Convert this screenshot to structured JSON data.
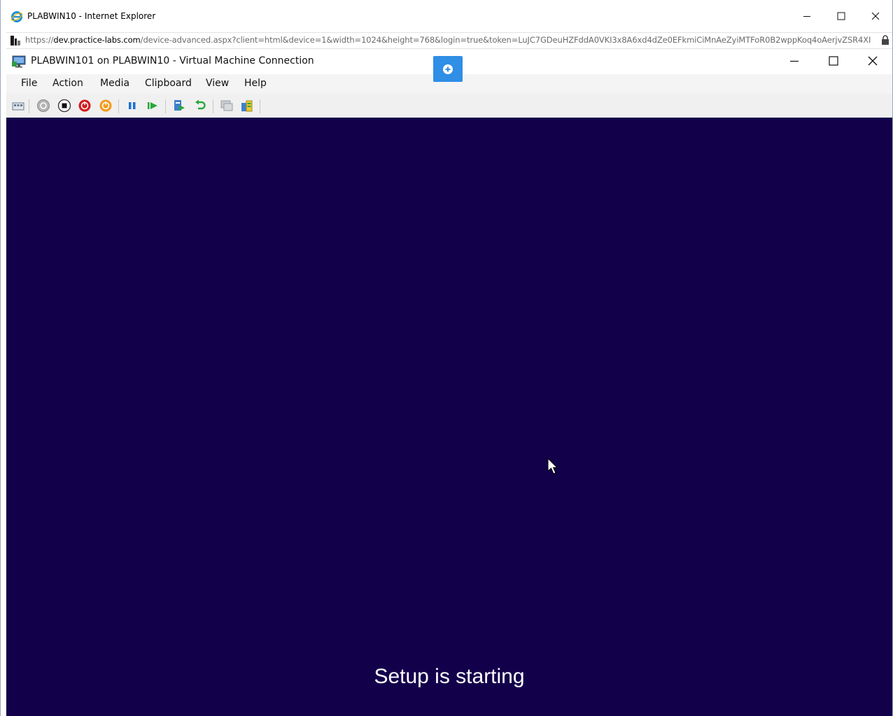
{
  "browser": {
    "title": "PLABWIN10 - Internet Explorer",
    "url_scheme": "https://",
    "url_host": "dev.practice-labs.com",
    "url_path": "/device-advanced.aspx?client=html&device=1&width=1024&height=768&login=true&token=LuJC7GDeuHZFddA0VKI3x8A6xd4dZe0EFkmiCiMnAeZyiMTFoR0B2wppKoq4oAerjvZSR4XI",
    "icons": {
      "logo": "ie-logo-icon",
      "site": "site-favicon-icon",
      "lock": "lock-icon"
    }
  },
  "vm": {
    "title": "PLABWIN101 on PLABWIN10 - Virtual Machine Connection",
    "menu": [
      "File",
      "Action",
      "Media",
      "Clipboard",
      "View",
      "Help"
    ],
    "toolbar_icons": [
      "ctrl-alt-del-icon",
      "start-icon",
      "turn-off-icon",
      "shut-down-icon",
      "save-state-icon",
      "pause-icon",
      "resume-icon",
      "checkpoint-icon",
      "revert-icon",
      "enhanced-session-icon",
      "zoom-icon"
    ],
    "screen_text": "Setup is starting",
    "screen_bg": "#13004b",
    "accent": "#2f8ee5"
  }
}
